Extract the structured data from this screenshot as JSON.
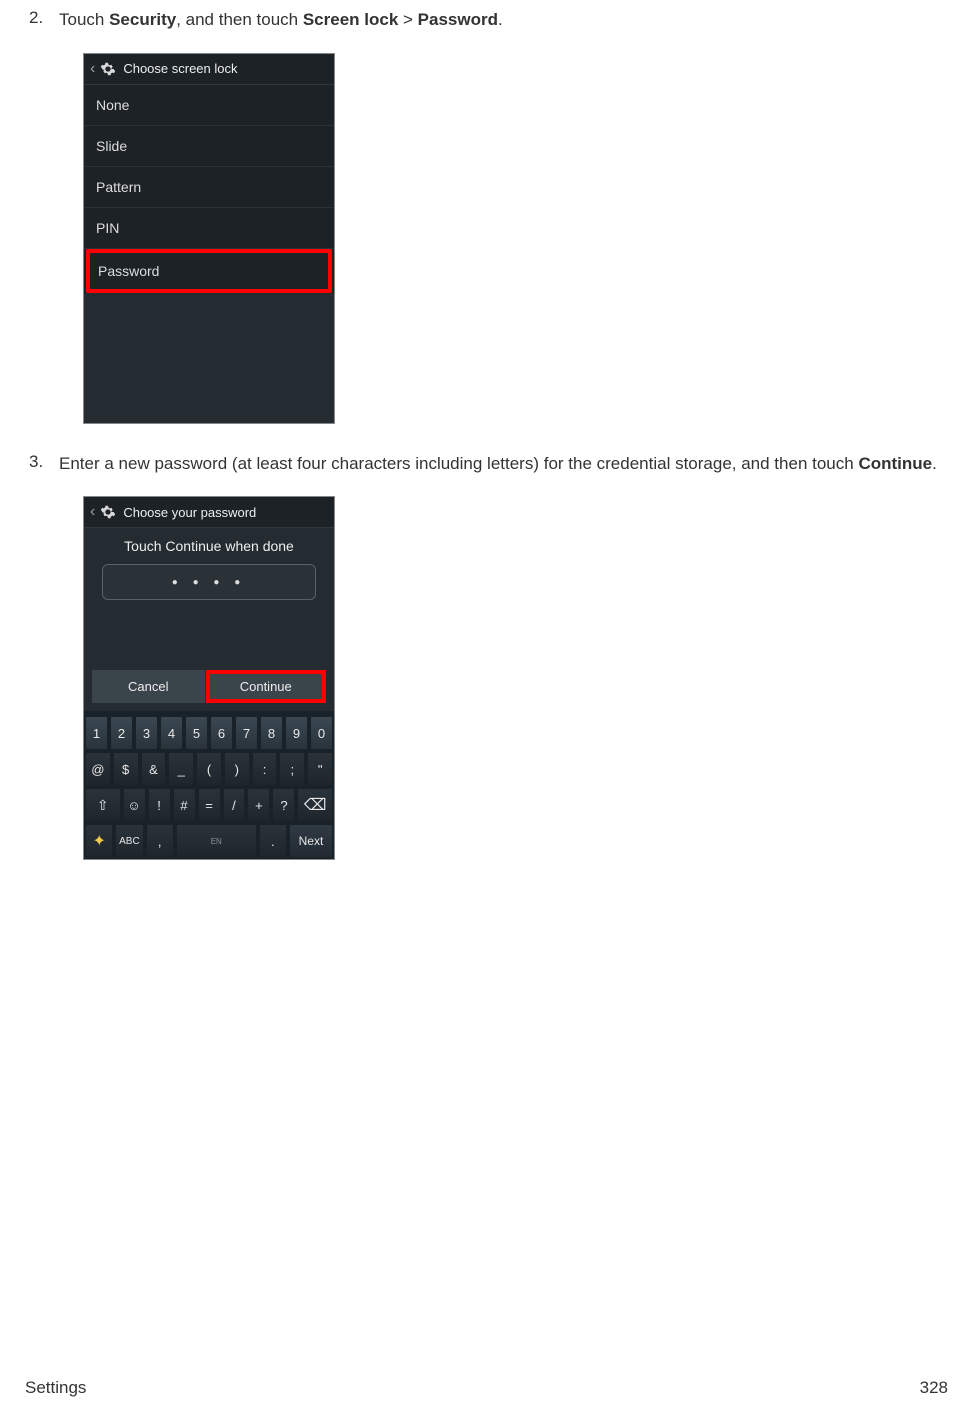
{
  "steps": {
    "s2": {
      "num": "2.",
      "pre": "Touch ",
      "bold1": "Security",
      "mid": ", and then touch ",
      "bold2": "Screen lock",
      "sep": " > ",
      "bold3": "Password",
      "end": "."
    },
    "s3": {
      "num": "3.",
      "pre": "Enter a new password (at least four characters including letters) for the credential storage, and then touch ",
      "bold1": "Continue",
      "end": "."
    }
  },
  "shot1": {
    "title": "Choose screen lock",
    "items": [
      "None",
      "Slide",
      "Pattern",
      "PIN"
    ],
    "highlighted": "Password"
  },
  "shot2": {
    "title": "Choose your password",
    "subheader": "Touch Continue when done",
    "dots": "● ● ● ●",
    "cancel": "Cancel",
    "cont": "Continue",
    "keys": {
      "row1": [
        "1",
        "2",
        "3",
        "4",
        "5",
        "6",
        "7",
        "8",
        "9",
        "0"
      ],
      "row2": [
        "@",
        "$",
        "&",
        "_",
        "(",
        ")",
        ":",
        ";",
        "\""
      ],
      "row3": [
        "⇧",
        "☺",
        "!",
        "#",
        "=",
        "/",
        "+",
        "?",
        "⌫"
      ],
      "row4_abc": "ABC",
      "row4_comma": ",",
      "row4_space": "EN",
      "row4_period": ".",
      "row4_next": "Next"
    }
  },
  "footer": {
    "section": "Settings",
    "page": "328"
  }
}
